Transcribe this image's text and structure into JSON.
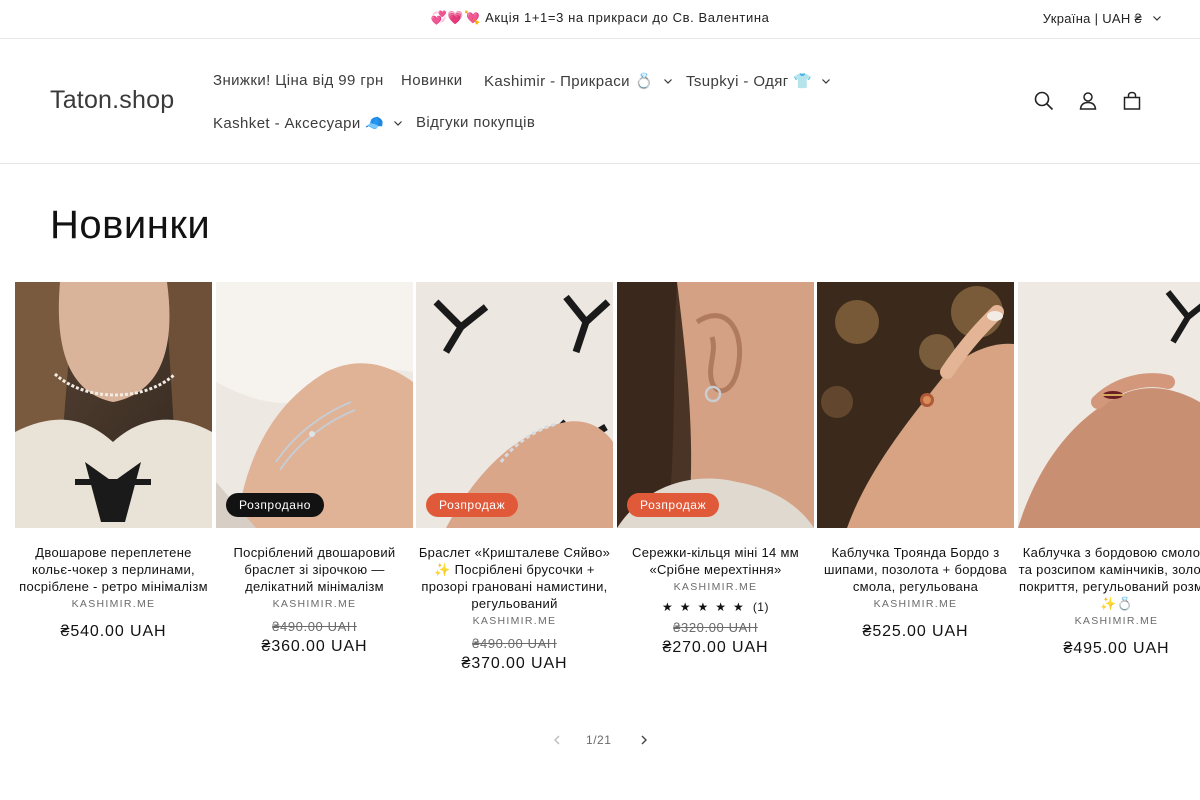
{
  "announcement": {
    "text": "💞💗💘 Акція 1+1=3 на прикраси до Св. Валентина"
  },
  "locale": {
    "label": "Україна | UAH ₴"
  },
  "header": {
    "logo": "Taton.shop",
    "nav": [
      {
        "label": "Знижки! Ціна від 99 грн"
      },
      {
        "label": "Новинки"
      },
      {
        "label": "Kashimir - Прикраси 💍"
      },
      {
        "label": "Tsupkyi - Одяг 👕"
      },
      {
        "label": "Kashket - Аксесуари 🧢"
      },
      {
        "label": "Відгуки покупців"
      }
    ],
    "icons": [
      "search-icon",
      "account-icon",
      "cart-icon"
    ]
  },
  "section": {
    "title": "Новинки"
  },
  "products": [
    {
      "title": "Двошарове переплетене кольє-чокер з перлинами, посріблене - ретро мінімалізм",
      "vendor": "KASHIMIR.ME",
      "badge": "",
      "old_price": "",
      "price": "₴540.00 UAH"
    },
    {
      "title": "Посріблений двошаровий браслет зі зірочкою — делікатний мінімалізм",
      "vendor": "KASHIMIR.ME",
      "badge": "Розпродано",
      "old_price": "₴490.00 UAH",
      "price": "₴360.00 UAH"
    },
    {
      "title": "Браслет «Кришталеве Сяйво» ✨ Посріблені брусочки + прозорі грановані намистини, регульований",
      "vendor": "KASHIMIR.ME",
      "badge": "Розпродаж",
      "old_price": "₴490.00 UAH",
      "price": "₴370.00 UAH"
    },
    {
      "title": "Сережки-кільця міні 14 мм «Срібне мерехтіння»",
      "vendor": "KASHIMIR.ME",
      "badge": "Розпродаж",
      "rating_stars": "★★★★★",
      "rating_count": "(1)",
      "rating_value": 5,
      "old_price": "₴320.00 UAH",
      "price": "₴270.00 UAH"
    },
    {
      "title": "Каблучка Троянда Бордо з шипами, позолота + бордова смола, регульована",
      "vendor": "KASHIMIR.ME",
      "badge": "",
      "old_price": "",
      "price": "₴525.00 UAH"
    },
    {
      "title": "Каблучка з бордовою смолою та розсипом камінчиків, золоте покриття, регульований розмір ✨💍",
      "vendor": "KASHIMIR.ME",
      "badge": "",
      "old_price": "",
      "price": "₴495.00 UAH"
    }
  ],
  "pagination": {
    "current": "1",
    "separator": "/",
    "total": "21"
  },
  "colors": {
    "sale_badge": "#e05a3a",
    "sold_badge": "#121212",
    "text": "#121212",
    "muted": "#6b6b6b"
  }
}
